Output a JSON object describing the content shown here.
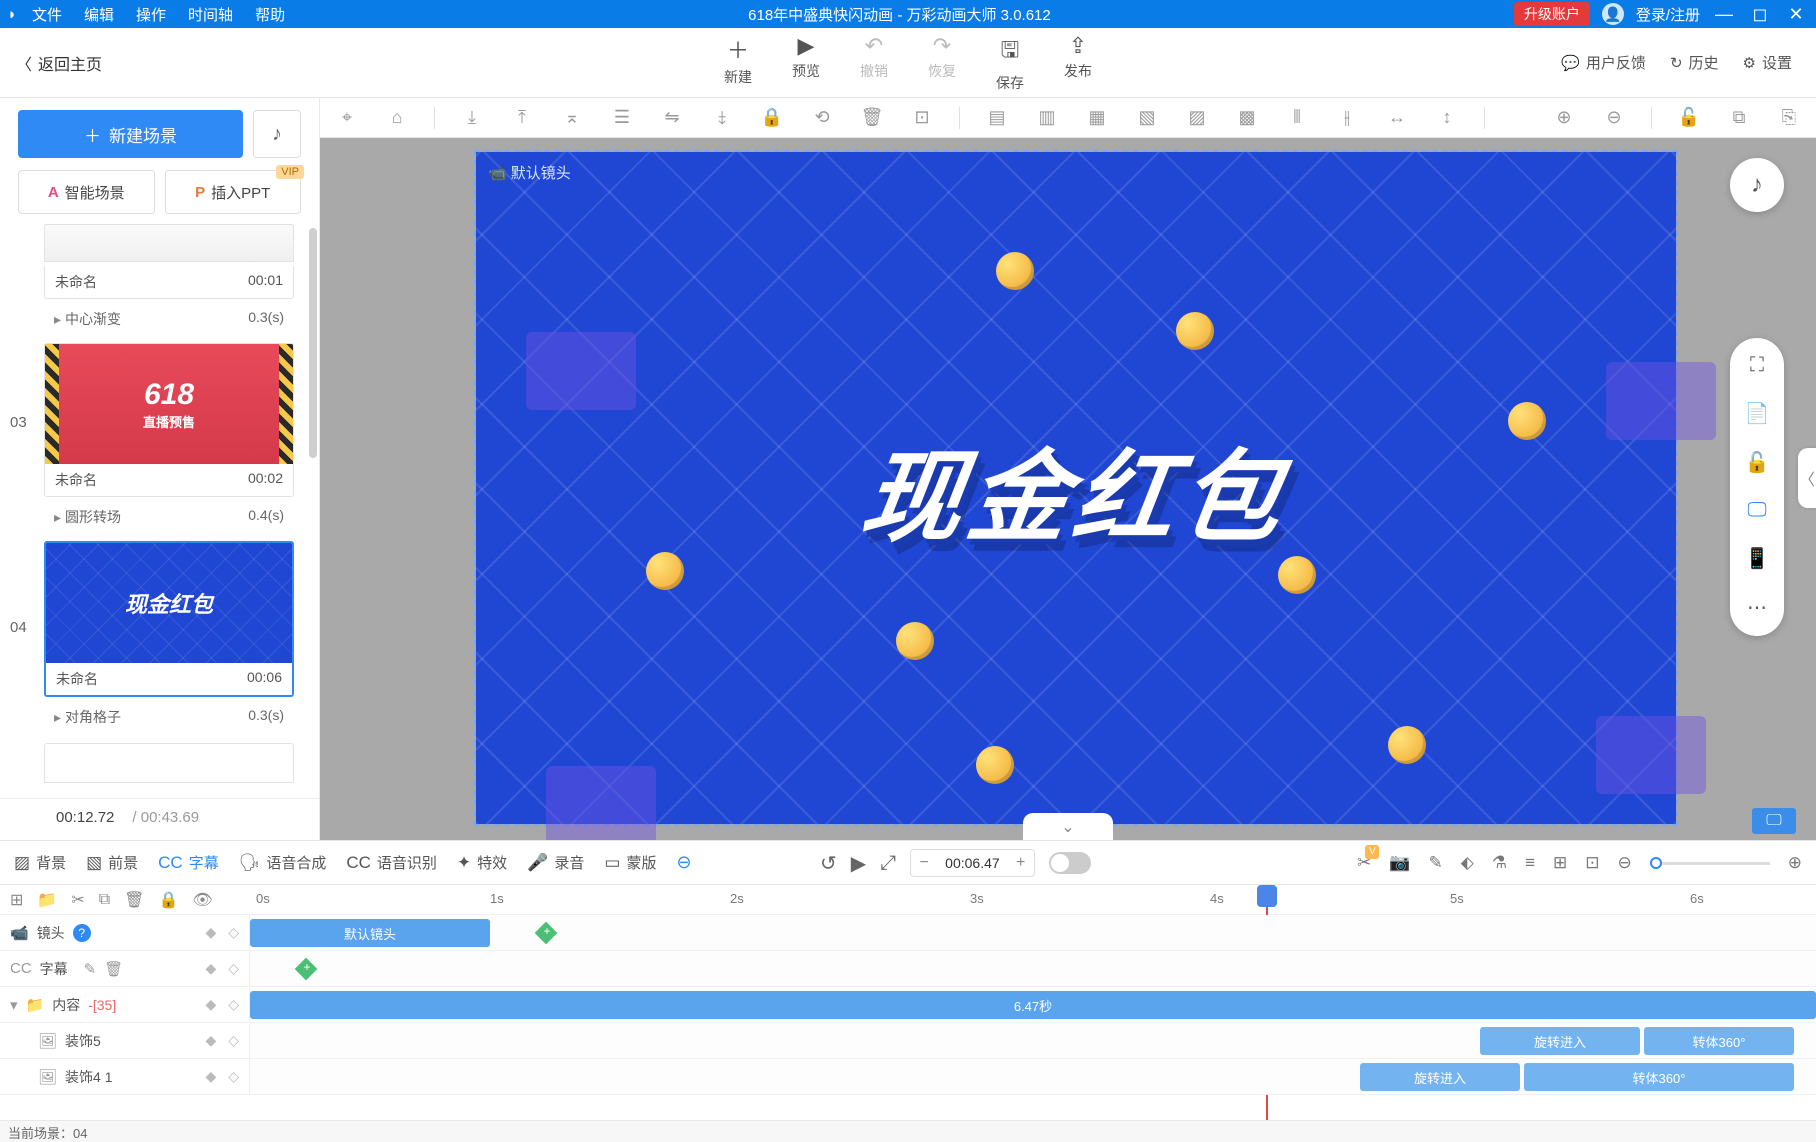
{
  "app": {
    "title": "618年中盛典快闪动画 - 万彩动画大师 3.0.612",
    "menus": [
      "文件",
      "编辑",
      "操作",
      "时间轴",
      "帮助"
    ],
    "upgrade": "升级账户",
    "login": "登录/注册"
  },
  "topbar": {
    "back": "返回主页",
    "buttons": [
      {
        "icon": "＋",
        "label": "新建"
      },
      {
        "icon": "▶",
        "label": "预览"
      },
      {
        "icon": "↶",
        "label": "撤销",
        "disabled": true
      },
      {
        "icon": "↷",
        "label": "恢复",
        "disabled": true
      },
      {
        "icon": "🖫",
        "label": "保存"
      },
      {
        "icon": "⇪",
        "label": "发布"
      }
    ],
    "right": [
      {
        "icon": "💬",
        "label": "用户反馈"
      },
      {
        "icon": "↻",
        "label": "历史"
      },
      {
        "icon": "⚙",
        "label": "设置"
      }
    ]
  },
  "left": {
    "new_scene": "新建场景",
    "smart_scene": "智能场景",
    "insert_ppt": "插入PPT",
    "vip": "VIP",
    "scenes": [
      {
        "num": "",
        "name": "未命名",
        "dur": "00:01",
        "transition": "中心渐变",
        "tdur": "0.3(s)"
      },
      {
        "num": "03",
        "name": "未命名",
        "dur": "00:02",
        "transition": "圆形转场",
        "tdur": "0.4(s)",
        "thumb_text": "618",
        "thumb_sub": "直播预售"
      },
      {
        "num": "04",
        "name": "未命名",
        "dur": "00:06",
        "transition": "对角格子",
        "tdur": "0.3(s)",
        "thumb_text": "现金红包",
        "selected": true
      }
    ],
    "current_time": "00:12.72",
    "total_time": "/ 00:43.69"
  },
  "canvas": {
    "camera_label": "默认镜头",
    "main_text": "现金红包"
  },
  "bottom_tabs": [
    {
      "icon": "▨",
      "label": "背景"
    },
    {
      "icon": "▧",
      "label": "前景"
    },
    {
      "icon": "CC",
      "label": "字幕",
      "active": true
    },
    {
      "icon": "🗣",
      "label": "语音合成"
    },
    {
      "icon": "CC",
      "label": "语音识别"
    },
    {
      "icon": "✦",
      "label": "特效"
    },
    {
      "icon": "🎤",
      "label": "录音"
    },
    {
      "icon": "▭",
      "label": "蒙版"
    }
  ],
  "playback": {
    "time": "00:06.47"
  },
  "ruler": [
    "0s",
    "1s",
    "2s",
    "3s",
    "4s",
    "5s",
    "6s"
  ],
  "tracks": {
    "camera": {
      "label": "镜头",
      "clip": "默认镜头"
    },
    "subtitle": {
      "label": "字幕"
    },
    "content": {
      "label": "内容",
      "count": "-[35]",
      "clip": "6.47秒"
    },
    "deco5": {
      "label": "装饰5",
      "effect1": "旋转进入",
      "effect2": "转体360°"
    },
    "deco41": {
      "label": "装饰4 1",
      "effect1": "旋转进入",
      "effect2": "转体360°"
    }
  },
  "status": "当前场景：04"
}
